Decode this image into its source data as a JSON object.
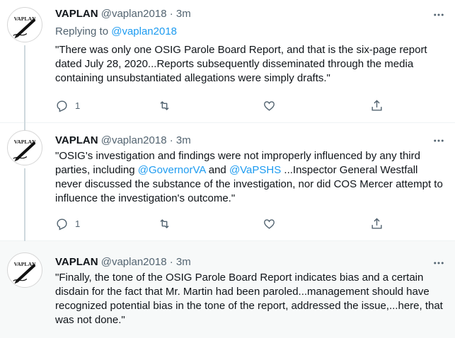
{
  "tweets": [
    {
      "name": "VAPLAN",
      "handle": "@vaplan2018",
      "dot": "·",
      "time": "3m",
      "replying_prefix": "Replying to ",
      "replying_to": "@vaplan2018",
      "text": "\"There was only one OSIG Parole Board Report, and that is the six-page report dated July 28, 2020...Reports subsequently disseminated through the media containing unsubstantiated allegations were simply drafts.\"",
      "reply_count": "1",
      "retweet_count": "",
      "like_count": ""
    },
    {
      "name": "VAPLAN",
      "handle": "@vaplan2018",
      "dot": "·",
      "time": "3m",
      "text_part1": "\"OSIG's investigation and findings were not improperly influenced by any third parties, including ",
      "mention1": "@GovernorVA",
      "text_and": " and ",
      "mention2": "@VaPSHS",
      "text_part2": " ...Inspector General Westfall never discussed the substance of the investigation, nor did COS Mercer attempt to influence the investigation's outcome.\"",
      "reply_count": "1",
      "retweet_count": "",
      "like_count": ""
    },
    {
      "name": "VAPLAN",
      "handle": "@vaplan2018",
      "dot": "·",
      "time": "3m",
      "text": "\"Finally, the tone of the OSIG Parole Board Report indicates bias and a certain disdain for the fact that Mr. Martin had been paroled...management should have recognized potential bias in the tone of the report, addressed the issue,...here, that was not done.\""
    }
  ],
  "avatar_label": "VAPLAN",
  "colors": {
    "link": "#1d9bf0",
    "secondary": "#536471",
    "highlight_bg": "#f7f9f9"
  },
  "icons": [
    "reply-icon",
    "retweet-icon",
    "like-icon",
    "share-icon",
    "more-icon",
    "avatar-pen-logo"
  ]
}
